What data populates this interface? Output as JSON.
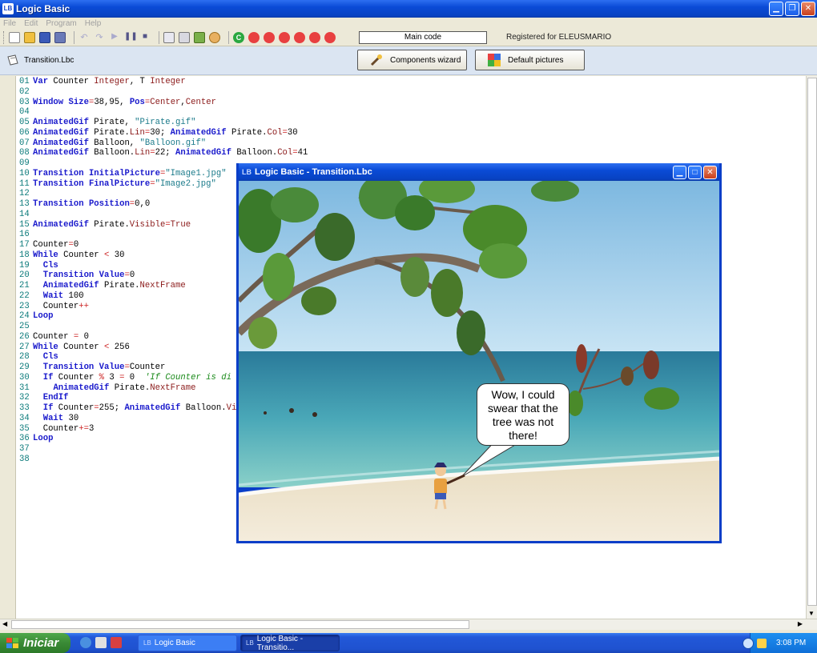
{
  "window": {
    "title": "Logic Basic",
    "icon": "LB"
  },
  "menu": [
    "File",
    "Edit",
    "Program",
    "Help"
  ],
  "toolbar": {
    "main_code": "Main code",
    "registered": "Registered for ELEUSMARIO"
  },
  "filebar": {
    "file_name": "Transition.Lbc",
    "components_wizard": "Components wizard",
    "default_pictures": "Default pictures"
  },
  "code_lines": [
    [
      [
        "n",
        "01"
      ],
      [
        "k",
        "Var"
      ],
      [
        "t",
        " Counter "
      ],
      [
        "y",
        "Integer"
      ],
      [
        "t",
        ", T "
      ],
      [
        "y",
        "Integer"
      ]
    ],
    [
      [
        "n",
        "02"
      ]
    ],
    [
      [
        "n",
        "03"
      ],
      [
        "k",
        "Window"
      ],
      [
        "t",
        " "
      ],
      [
        "k",
        "Size"
      ],
      [
        "o",
        "="
      ],
      [
        "t",
        "38,95, "
      ],
      [
        "k",
        "Pos"
      ],
      [
        "o",
        "="
      ],
      [
        "y",
        "Center"
      ],
      [
        "t",
        ","
      ],
      [
        "y",
        "Center"
      ]
    ],
    [
      [
        "n",
        "04"
      ]
    ],
    [
      [
        "n",
        "05"
      ],
      [
        "k",
        "AnimatedGif"
      ],
      [
        "t",
        " Pirate, "
      ],
      [
        "s",
        "\"Pirate.gif\""
      ]
    ],
    [
      [
        "n",
        "06"
      ],
      [
        "k",
        "AnimatedGif"
      ],
      [
        "t",
        " Pirate."
      ],
      [
        "y",
        "Lin"
      ],
      [
        "o",
        "="
      ],
      [
        "t",
        "30; "
      ],
      [
        "k",
        "AnimatedGif"
      ],
      [
        "t",
        " Pirate."
      ],
      [
        "y",
        "Col"
      ],
      [
        "o",
        "="
      ],
      [
        "t",
        "30"
      ]
    ],
    [
      [
        "n",
        "07"
      ],
      [
        "k",
        "AnimatedGif"
      ],
      [
        "t",
        " Balloon, "
      ],
      [
        "s",
        "\"Balloon.gif\""
      ]
    ],
    [
      [
        "n",
        "08"
      ],
      [
        "k",
        "AnimatedGif"
      ],
      [
        "t",
        " Balloon."
      ],
      [
        "y",
        "Lin"
      ],
      [
        "o",
        "="
      ],
      [
        "t",
        "22; "
      ],
      [
        "k",
        "AnimatedGif"
      ],
      [
        "t",
        " Balloon."
      ],
      [
        "y",
        "Col"
      ],
      [
        "o",
        "="
      ],
      [
        "t",
        "41"
      ]
    ],
    [
      [
        "n",
        "09"
      ]
    ],
    [
      [
        "n",
        "10"
      ],
      [
        "k",
        "Transition"
      ],
      [
        "t",
        " "
      ],
      [
        "k",
        "InitialPicture"
      ],
      [
        "o",
        "="
      ],
      [
        "s",
        "\"Image1.jpg\""
      ]
    ],
    [
      [
        "n",
        "11"
      ],
      [
        "k",
        "Transition"
      ],
      [
        "t",
        " "
      ],
      [
        "k",
        "FinalPicture"
      ],
      [
        "o",
        "="
      ],
      [
        "s",
        "\"Image2.jpg\""
      ]
    ],
    [
      [
        "n",
        "12"
      ]
    ],
    [
      [
        "n",
        "13"
      ],
      [
        "k",
        "Transition"
      ],
      [
        "t",
        " "
      ],
      [
        "k",
        "Position"
      ],
      [
        "o",
        "="
      ],
      [
        "t",
        "0,0"
      ]
    ],
    [
      [
        "n",
        "14"
      ]
    ],
    [
      [
        "n",
        "15"
      ],
      [
        "k",
        "AnimatedGif"
      ],
      [
        "t",
        " Pirate."
      ],
      [
        "y",
        "Visible"
      ],
      [
        "o",
        "="
      ],
      [
        "y",
        "True"
      ]
    ],
    [
      [
        "n",
        "16"
      ]
    ],
    [
      [
        "n",
        "17"
      ],
      [
        "t",
        "Counter"
      ],
      [
        "o",
        "="
      ],
      [
        "t",
        "0"
      ]
    ],
    [
      [
        "n",
        "18"
      ],
      [
        "k",
        "While"
      ],
      [
        "t",
        " Counter "
      ],
      [
        "o",
        "<"
      ],
      [
        "t",
        " 30"
      ]
    ],
    [
      [
        "n",
        "19"
      ],
      [
        "t",
        "  "
      ],
      [
        "k",
        "Cls"
      ]
    ],
    [
      [
        "n",
        "20"
      ],
      [
        "t",
        "  "
      ],
      [
        "k",
        "Transition"
      ],
      [
        "t",
        " "
      ],
      [
        "k",
        "Value"
      ],
      [
        "o",
        "="
      ],
      [
        "t",
        "0"
      ]
    ],
    [
      [
        "n",
        "21"
      ],
      [
        "t",
        "  "
      ],
      [
        "k",
        "AnimatedGif"
      ],
      [
        "t",
        " Pirate."
      ],
      [
        "y",
        "NextFrame"
      ]
    ],
    [
      [
        "n",
        "22"
      ],
      [
        "t",
        "  "
      ],
      [
        "k",
        "Wait"
      ],
      [
        "t",
        " 100"
      ]
    ],
    [
      [
        "n",
        "23"
      ],
      [
        "t",
        "  Counter"
      ],
      [
        "o",
        "++"
      ]
    ],
    [
      [
        "n",
        "24"
      ],
      [
        "k",
        "Loop"
      ]
    ],
    [
      [
        "n",
        "25"
      ]
    ],
    [
      [
        "n",
        "26"
      ],
      [
        "t",
        "Counter "
      ],
      [
        "o",
        "="
      ],
      [
        "t",
        " 0"
      ]
    ],
    [
      [
        "n",
        "27"
      ],
      [
        "k",
        "While"
      ],
      [
        "t",
        " Counter "
      ],
      [
        "o",
        "<"
      ],
      [
        "t",
        " 256"
      ]
    ],
    [
      [
        "n",
        "28"
      ],
      [
        "t",
        "  "
      ],
      [
        "k",
        "Cls"
      ]
    ],
    [
      [
        "n",
        "29"
      ],
      [
        "t",
        "  "
      ],
      [
        "k",
        "Transition"
      ],
      [
        "t",
        " "
      ],
      [
        "k",
        "Value"
      ],
      [
        "o",
        "="
      ],
      [
        "t",
        "Counter"
      ]
    ],
    [
      [
        "n",
        "30"
      ],
      [
        "t",
        "  "
      ],
      [
        "k",
        "If"
      ],
      [
        "t",
        " Counter "
      ],
      [
        "o",
        "%"
      ],
      [
        "t",
        " 3 "
      ],
      [
        "o",
        "="
      ],
      [
        "t",
        " 0  "
      ],
      [
        "c",
        "'If Counter is di"
      ]
    ],
    [
      [
        "n",
        "31"
      ],
      [
        "t",
        "    "
      ],
      [
        "k",
        "AnimatedGif"
      ],
      [
        "t",
        " Pirate."
      ],
      [
        "y",
        "NextFrame"
      ]
    ],
    [
      [
        "n",
        "32"
      ],
      [
        "t",
        "  "
      ],
      [
        "k",
        "EndIf"
      ]
    ],
    [
      [
        "n",
        "33"
      ],
      [
        "t",
        "  "
      ],
      [
        "k",
        "If"
      ],
      [
        "t",
        " Counter"
      ],
      [
        "o",
        "="
      ],
      [
        "t",
        "255; "
      ],
      [
        "k",
        "AnimatedGif"
      ],
      [
        "t",
        " Balloon."
      ],
      [
        "y",
        "Vi"
      ]
    ],
    [
      [
        "n",
        "34"
      ],
      [
        "t",
        "  "
      ],
      [
        "k",
        "Wait"
      ],
      [
        "t",
        " 30"
      ]
    ],
    [
      [
        "n",
        "35"
      ],
      [
        "t",
        "  Counter"
      ],
      [
        "o",
        "+="
      ],
      [
        "t",
        "3"
      ]
    ],
    [
      [
        "n",
        "36"
      ],
      [
        "k",
        "Loop"
      ]
    ],
    [
      [
        "n",
        "37"
      ]
    ],
    [
      [
        "n",
        "38"
      ]
    ]
  ],
  "child_window": {
    "title": "Logic Basic - Transition.Lbc",
    "icon": "LB"
  },
  "speech_bubble": "Wow, I could swear that the tree was not there!",
  "taskbar": {
    "start": "Iniciar",
    "task1": "Logic Basic",
    "task2": "Logic Basic - Transitio...",
    "task_icon": "LB",
    "clock": "3:08 PM"
  },
  "colors": {
    "title_blue": "#0a4bd6",
    "keyword": "#1a1acc",
    "string": "#1a7a8a",
    "comment": "#1a8a1a",
    "start_green": "#3a8a36"
  }
}
